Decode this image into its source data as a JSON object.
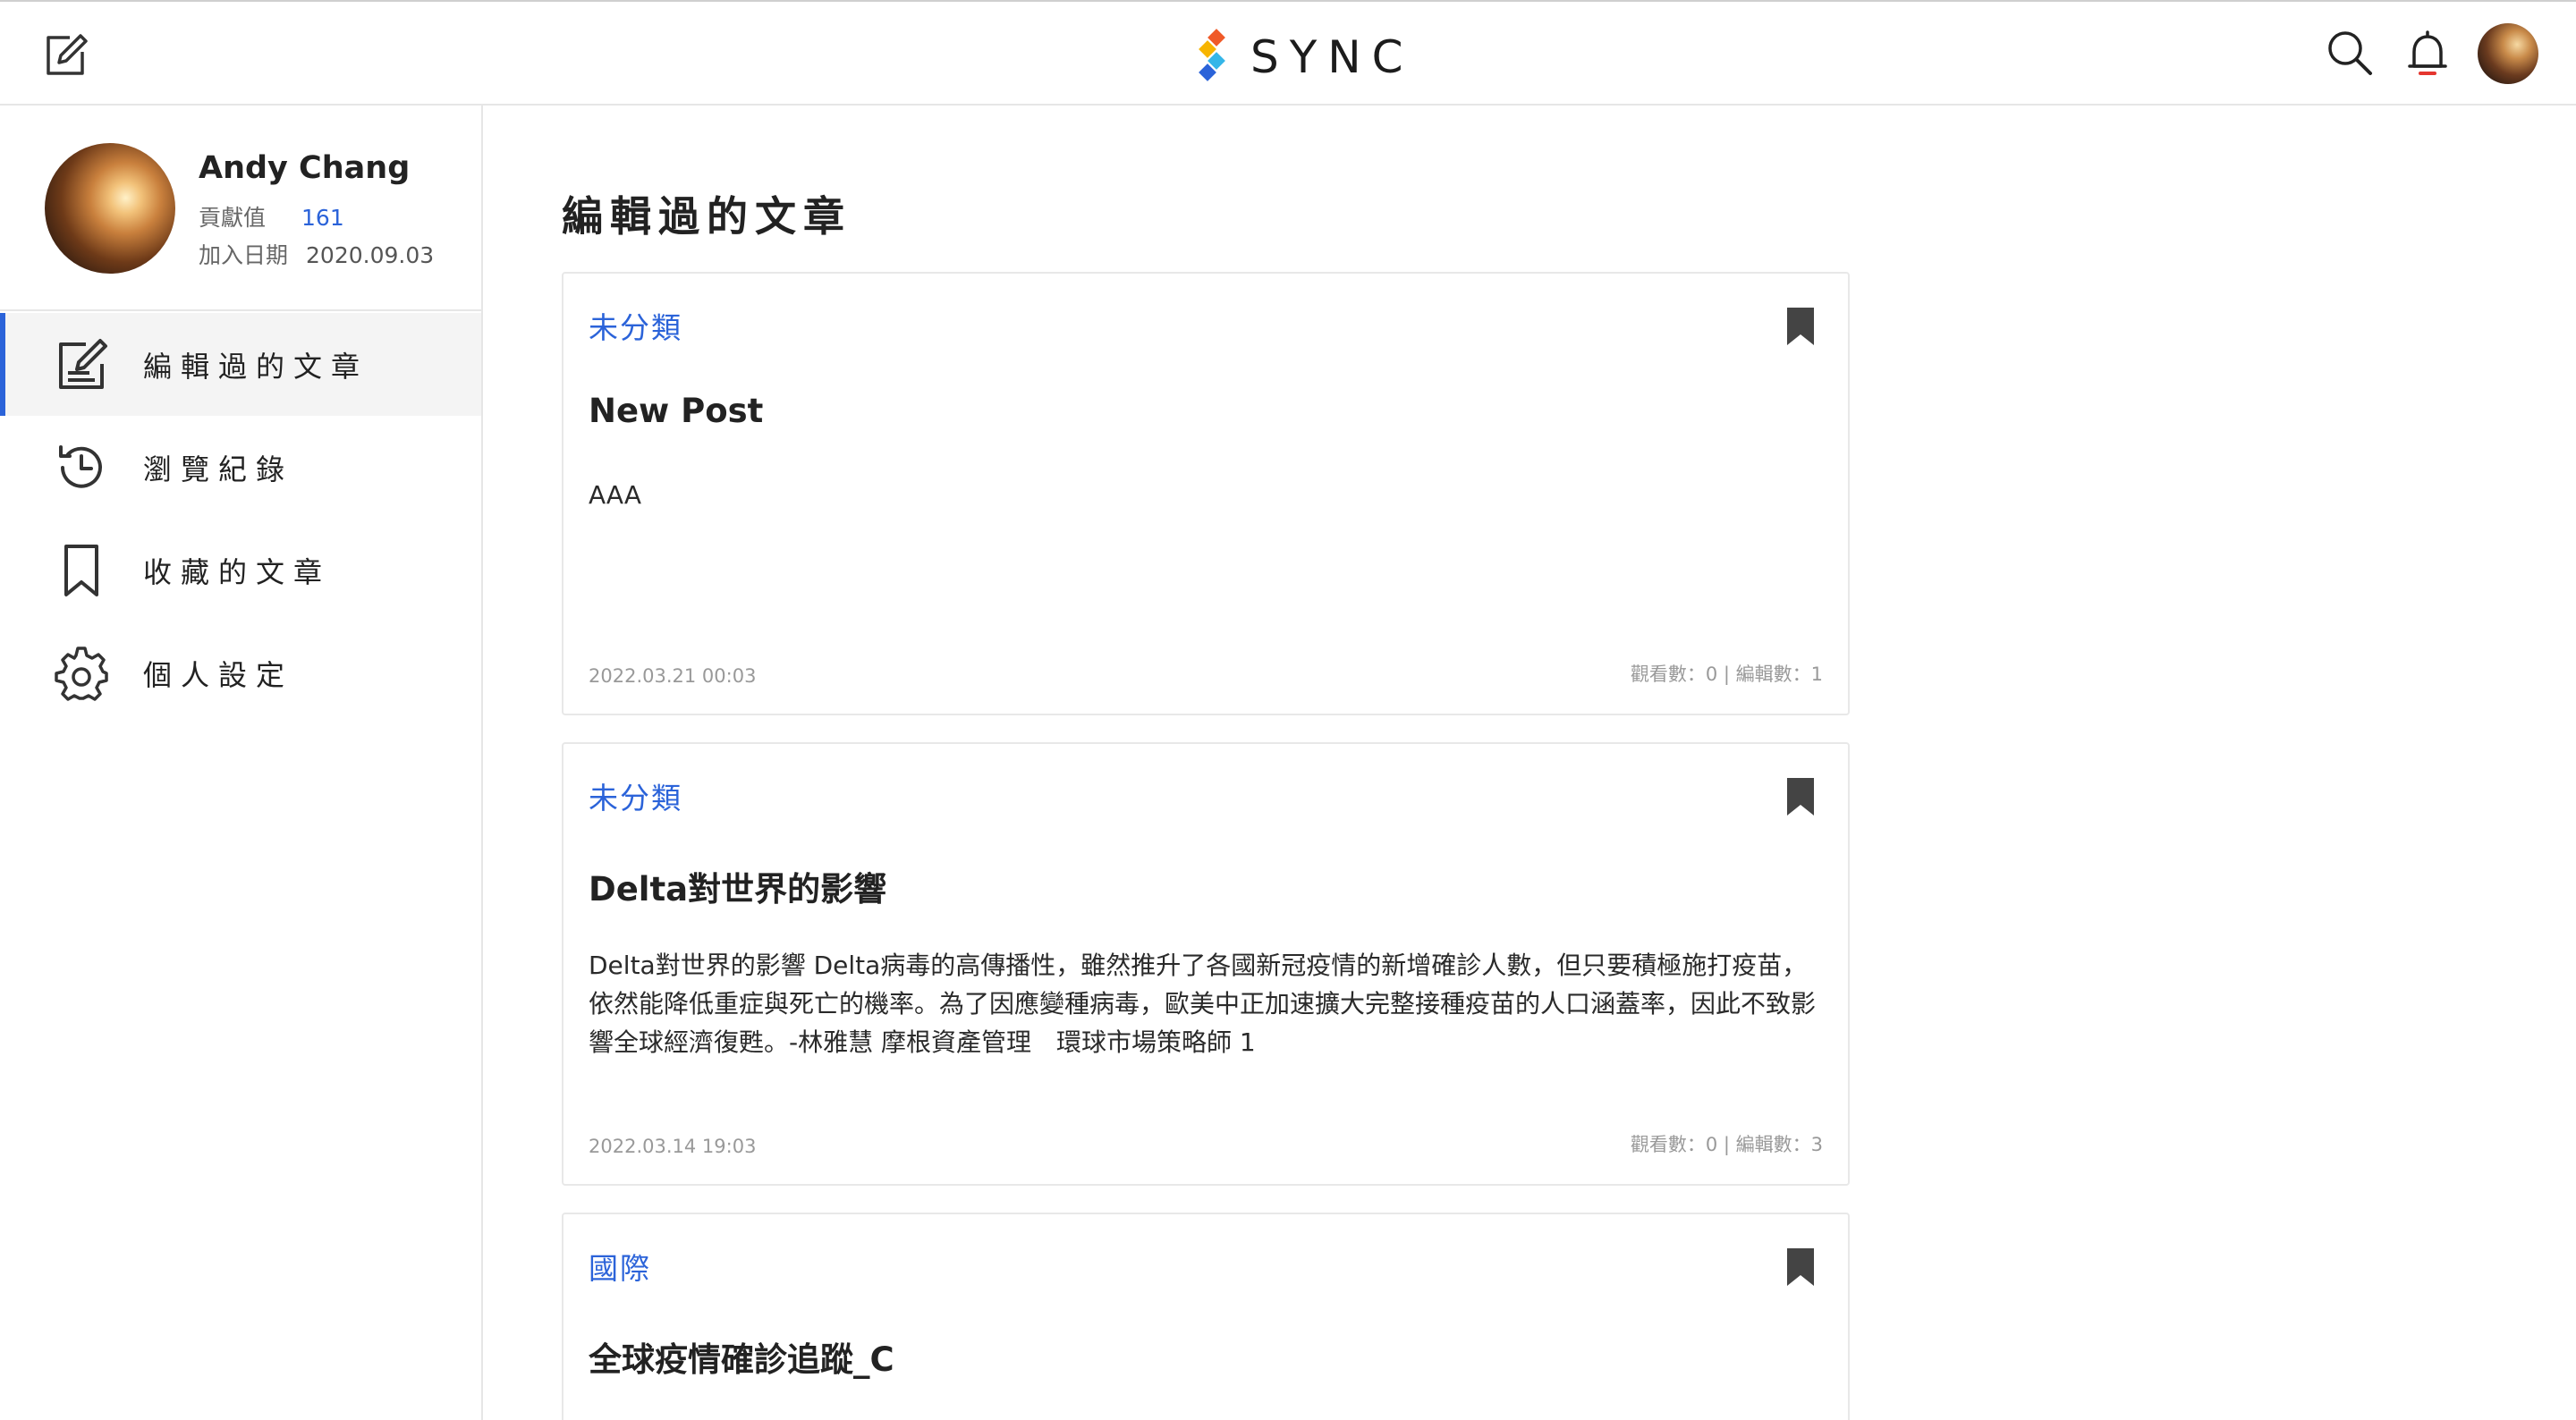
{
  "header": {
    "logo_text": "SYNC"
  },
  "profile": {
    "name": "Andy Chang",
    "contribution_label": "貢獻值",
    "contribution_value": "161",
    "join_label": "加入日期",
    "join_date": "2020.09.03"
  },
  "nav": {
    "items": [
      {
        "label": "編輯過的文章",
        "icon": "edit-icon",
        "active": true
      },
      {
        "label": "瀏覽紀錄",
        "icon": "history-icon",
        "active": false
      },
      {
        "label": "收藏的文章",
        "icon": "bookmark-icon",
        "active": false
      },
      {
        "label": "個人設定",
        "icon": "gear-icon",
        "active": false
      }
    ]
  },
  "main": {
    "title": "編輯過的文章",
    "posts": [
      {
        "category": "未分類",
        "title": "New Post",
        "body": "AAA",
        "date": "2022.03.21 00:03",
        "meta": "觀看數：0 | 編輯數：1"
      },
      {
        "category": "未分類",
        "title": "Delta對世界的影響",
        "body": "Delta對世界的影響 Delta病毒的高傳播性，雖然推升了各國新冠疫情的新增確診人數，但只要積極施打疫苗，依然能降低重症與死亡的機率。為了因應變種病毒，歐美中正加速擴大完整接種疫苗的人口涵蓋率，因此不致影響全球經濟復甦。-林雅慧 摩根資產管理　環球市場策略師 1",
        "date": "2022.03.14 19:03",
        "meta": "觀看數：0 | 編輯數：3"
      },
      {
        "category": "國際",
        "title": "全球疫情確診追蹤_C",
        "body": "",
        "date": "",
        "meta": ""
      }
    ]
  },
  "colors": {
    "accent": "#2b63d9",
    "text": "#222222",
    "muted": "#999999",
    "border": "#e6e6e6"
  }
}
